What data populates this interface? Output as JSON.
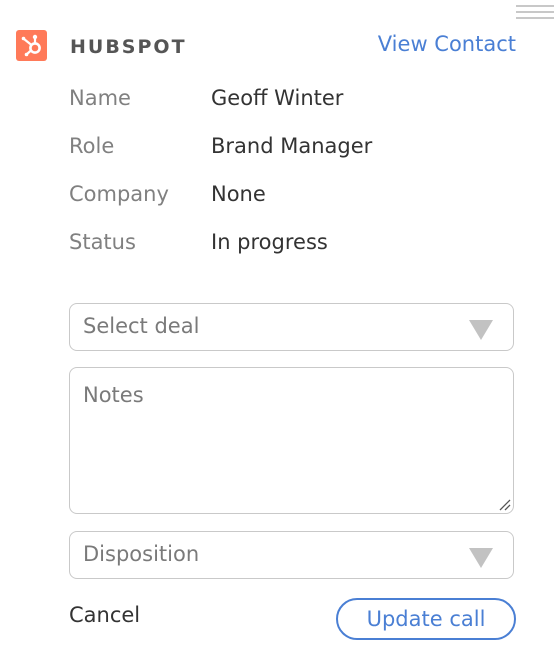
{
  "header": {
    "brand": "HUBSPOT",
    "view_contact_label": "View Contact"
  },
  "contact": {
    "fields": [
      {
        "label": "Name",
        "value": "Geoff Winter"
      },
      {
        "label": "Role",
        "value": "Brand Manager"
      },
      {
        "label": "Company",
        "value": "None"
      },
      {
        "label": "Status",
        "value": "In progress"
      }
    ]
  },
  "form": {
    "deal_select": {
      "placeholder": "Select deal",
      "icon": "triangle-down-icon"
    },
    "notes": {
      "placeholder": "Notes",
      "value": ""
    },
    "disposition_select": {
      "placeholder": "Disposition",
      "icon": "triangle-down-icon"
    }
  },
  "actions": {
    "cancel_label": "Cancel",
    "update_label": "Update call"
  },
  "colors": {
    "accent": "#4a7fd4",
    "brand_orange": "#ff7a59",
    "label_gray": "#808080",
    "text": "#333333",
    "border": "#c9c9c9"
  },
  "icons": {
    "logo": "hubspot-sprocket-icon",
    "drag": "drag-handle-icon",
    "resize": "resize-grip-icon"
  }
}
